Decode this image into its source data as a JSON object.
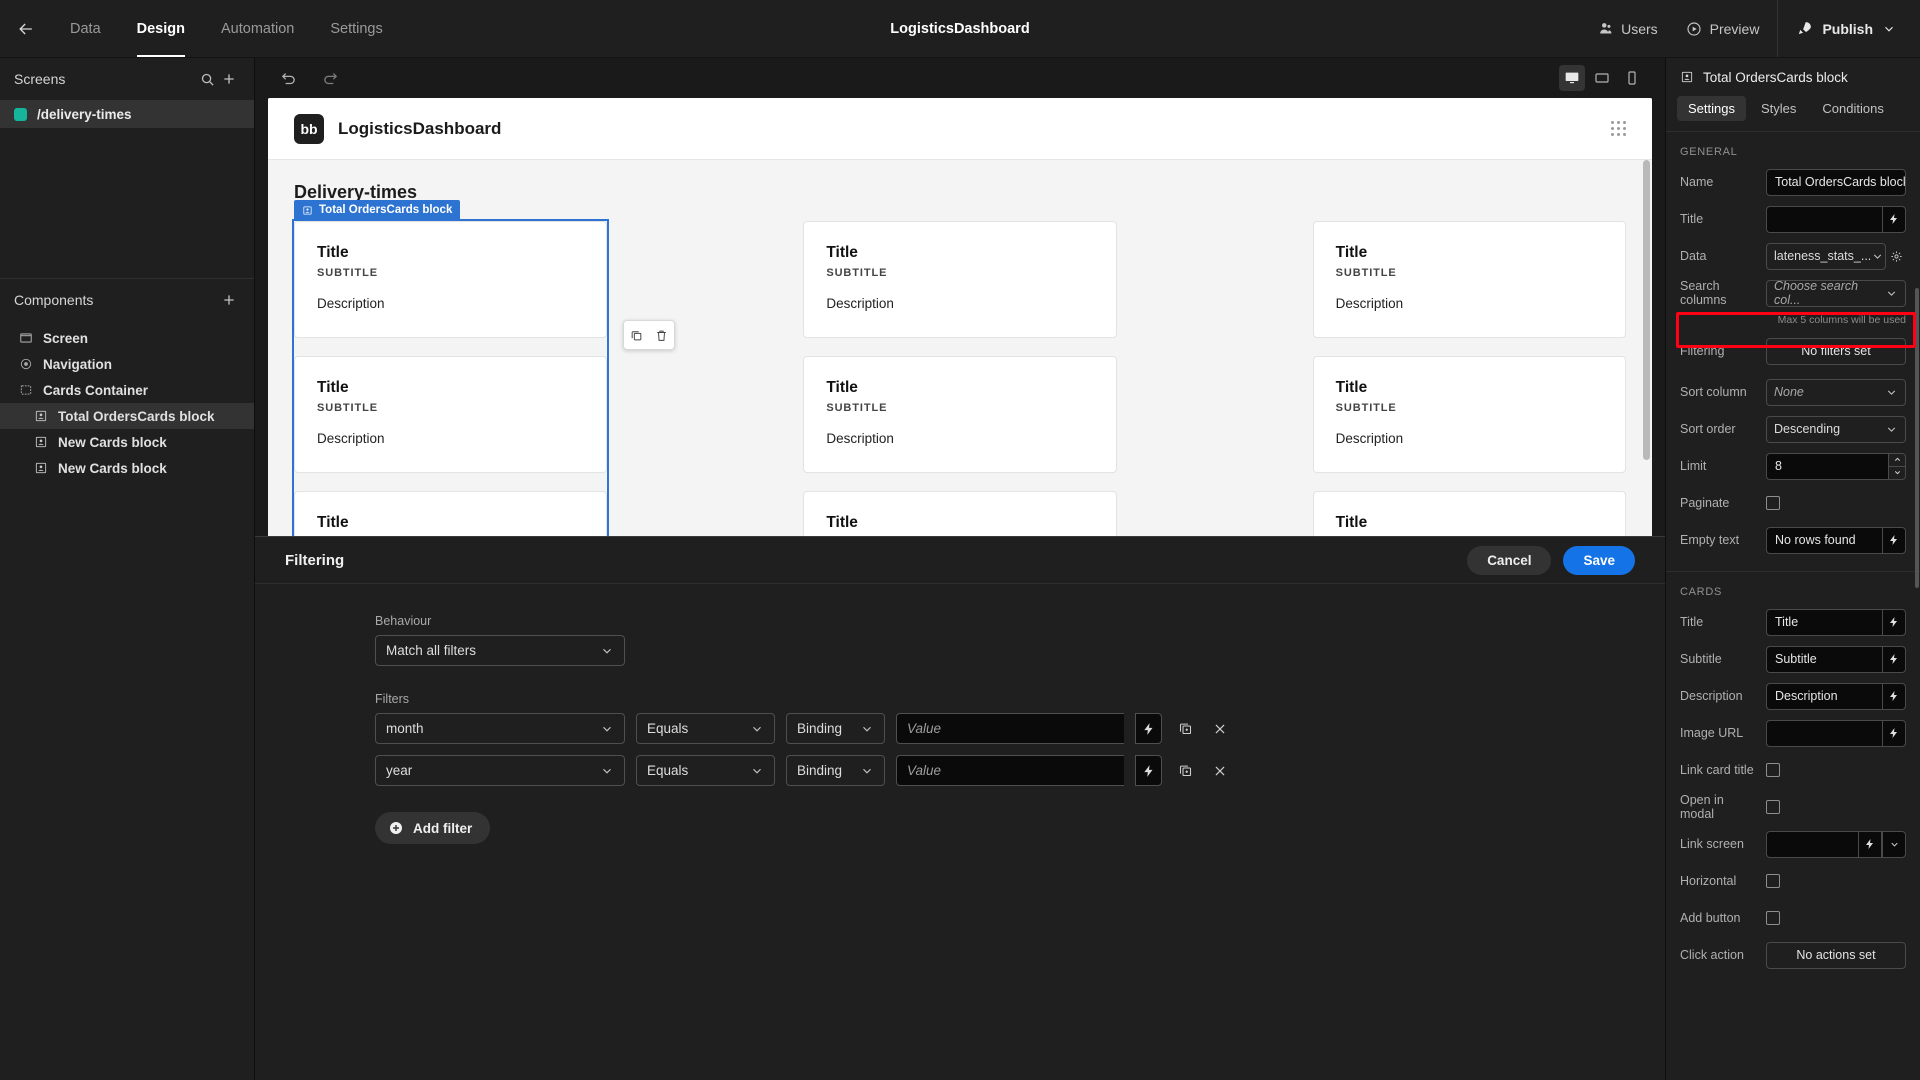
{
  "topbar": {
    "back_icon": "arrow-left-icon",
    "tabs": [
      {
        "label": "Data",
        "active": false
      },
      {
        "label": "Design",
        "active": true
      },
      {
        "label": "Automation",
        "active": false
      },
      {
        "label": "Settings",
        "active": false
      }
    ],
    "app_title": "LogisticsDashboard",
    "users_label": "Users",
    "preview_label": "Preview",
    "publish_label": "Publish"
  },
  "left": {
    "screens_header": "Screens",
    "screens": [
      {
        "label": "/delivery-times",
        "selected": true
      }
    ],
    "components_header": "Components",
    "components": [
      {
        "label": "Screen",
        "icon": "screen-icon",
        "indent": 0,
        "selected": false
      },
      {
        "label": "Navigation",
        "icon": "navigation-icon",
        "indent": 0,
        "selected": false
      },
      {
        "label": "Cards Container",
        "icon": "container-icon",
        "indent": 0,
        "selected": false
      },
      {
        "label": "Total OrdersCards block",
        "icon": "cards-block-icon",
        "indent": 1,
        "selected": true
      },
      {
        "label": "New Cards block",
        "icon": "cards-block-icon",
        "indent": 1,
        "selected": false
      },
      {
        "label": "New Cards block",
        "icon": "cards-block-icon",
        "indent": 1,
        "selected": false
      }
    ]
  },
  "center": {
    "undo_icon": "undo-icon",
    "redo_icon": "redo-icon",
    "devices": [
      {
        "name": "desktop-icon",
        "active": true
      },
      {
        "name": "tablet-icon",
        "active": false
      },
      {
        "name": "mobile-icon",
        "active": false
      }
    ],
    "canvas": {
      "logo_text": "bb",
      "nav_title": "LogisticsDashboard",
      "heading": "Delivery-times",
      "selection_tag": "Total OrdersCards block",
      "float_tools": [
        "duplicate-icon",
        "delete-icon"
      ],
      "card": {
        "title": "Title",
        "subtitle": "SUBTITLE",
        "description": "Description"
      },
      "columns": 3,
      "rows": 3
    }
  },
  "drawer": {
    "title": "Filtering",
    "cancel_label": "Cancel",
    "save_label": "Save",
    "behaviour_label": "Behaviour",
    "behaviour_value": "Match all filters",
    "filters_label": "Filters",
    "filters": [
      {
        "column": "month",
        "operator": "Equals",
        "type": "Binding",
        "value_placeholder": "Value"
      },
      {
        "column": "year",
        "operator": "Equals",
        "type": "Binding",
        "value_placeholder": "Value"
      }
    ],
    "add_filter_label": "Add filter"
  },
  "right": {
    "panel_title": "Total OrdersCards block",
    "panel_icon": "cards-block-icon",
    "tabs": [
      {
        "label": "Settings",
        "active": true
      },
      {
        "label": "Styles",
        "active": false
      },
      {
        "label": "Conditions",
        "active": false
      }
    ],
    "general_label": "GENERAL",
    "cards_label": "CARDS",
    "hint": "Max 5 columns will be used",
    "props": {
      "name_label": "Name",
      "name_value": "Total OrdersCards block",
      "title_label": "Title",
      "title_value": "",
      "data_label": "Data",
      "data_value": "lateness_stats_...",
      "search_columns_label": "Search columns",
      "search_columns_placeholder": "Choose search col...",
      "filtering_label": "Filtering",
      "filtering_value": "No filters set",
      "sort_column_label": "Sort column",
      "sort_column_value": "None",
      "sort_order_label": "Sort order",
      "sort_order_value": "Descending",
      "limit_label": "Limit",
      "limit_value": "8",
      "paginate_label": "Paginate",
      "paginate_checked": false,
      "empty_text_label": "Empty text",
      "empty_text_value": "No rows found",
      "card_title_label": "Title",
      "card_title_value": "Title",
      "card_subtitle_label": "Subtitle",
      "card_subtitle_value": "Subtitle",
      "card_description_label": "Description",
      "card_description_value": "Description",
      "image_url_label": "Image URL",
      "image_url_value": "",
      "link_card_title_label": "Link card title",
      "open_in_modal_label": "Open in modal",
      "link_screen_label": "Link screen",
      "link_screen_value": "",
      "horizontal_label": "Horizontal",
      "add_button_label": "Add button",
      "click_action_label": "Click action",
      "click_action_value": "No actions set"
    },
    "accent_color": "#1473e6",
    "highlight_color": "#ff0015"
  }
}
